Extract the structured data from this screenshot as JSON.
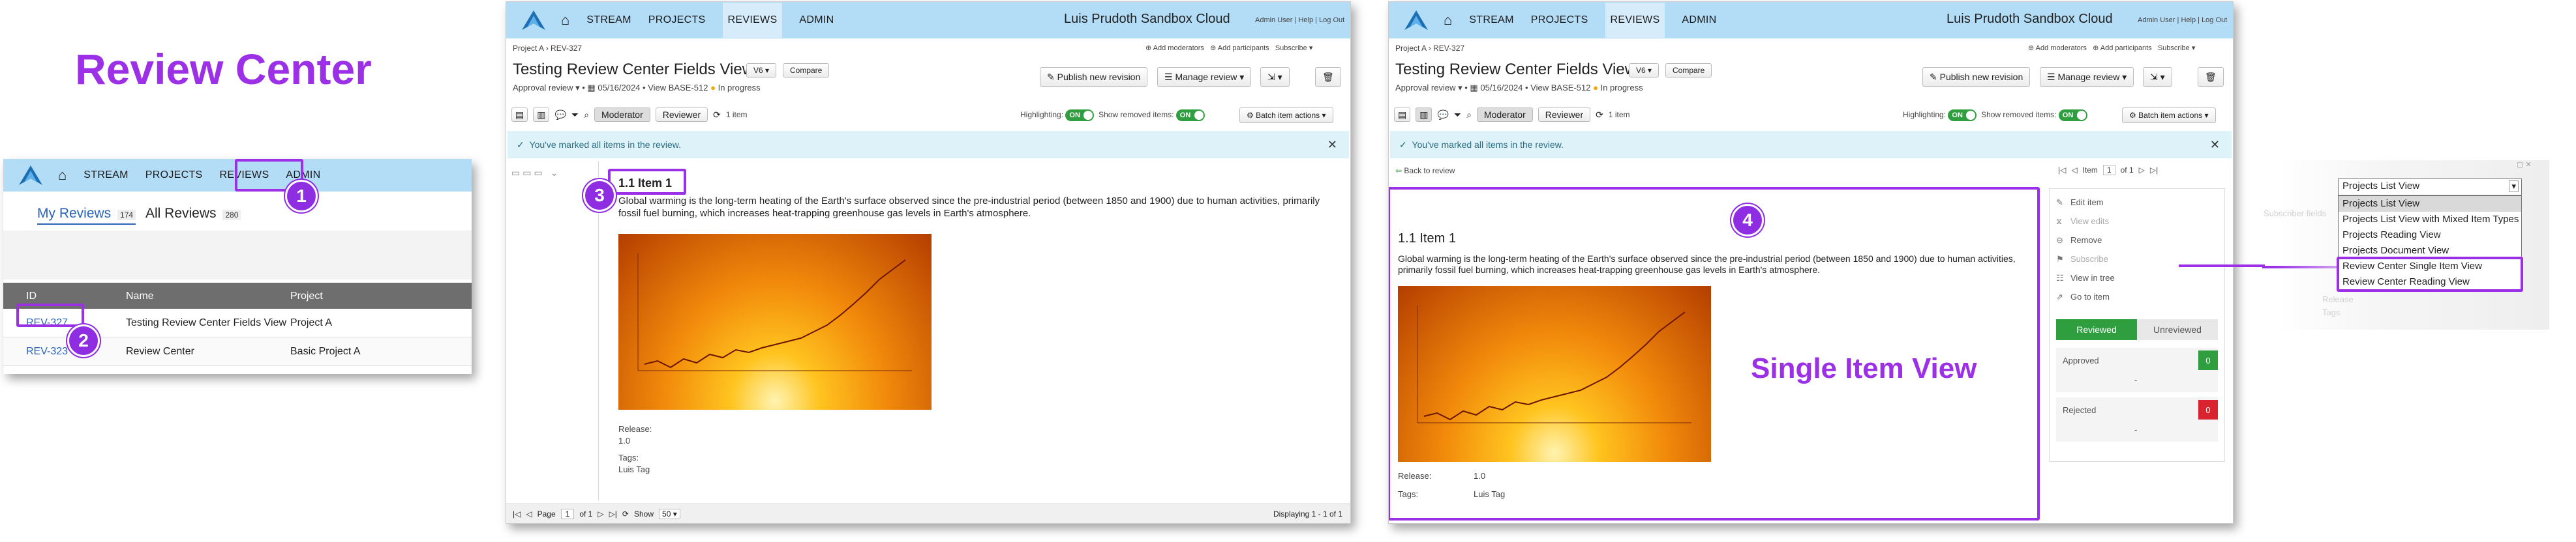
{
  "panel1": {
    "title": "Review Center",
    "nav": [
      "STREAM",
      "PROJECTS",
      "REVIEWS",
      "ADMIN"
    ],
    "tabs": [
      {
        "label": "My Reviews",
        "count": "174"
      },
      {
        "label": "All Reviews",
        "count": "280"
      }
    ],
    "columns": [
      "ID",
      "Name",
      "Project"
    ],
    "rows": [
      {
        "id": "REV-327",
        "name": "Testing Review Center Fields View",
        "project": "Project A"
      },
      {
        "id": "REV-323",
        "name": "Review Center",
        "project": "Basic Project A"
      }
    ],
    "callouts": [
      "1",
      "2"
    ]
  },
  "app": {
    "brand": "Luis Prudoth Sandbox Cloud",
    "nav": [
      "STREAM",
      "PROJECTS",
      "REVIEWS",
      "ADMIN"
    ],
    "user_links": [
      "Admin User",
      "Help",
      "Log Out"
    ],
    "breadcrumb": "Project A › REV-327",
    "add_moderators": "Add moderators",
    "add_participants": "Add participants",
    "subscribe": "Subscribe",
    "review_title": "Testing Review Center Fields View",
    "version": "V6",
    "compare": "Compare",
    "meta_type": "Approval review",
    "meta_date": "05/16/2024",
    "meta_view": "View BASE-512",
    "meta_status": "In progress",
    "publish": "Publish new revision",
    "manage": "Manage review",
    "moderator": "Moderator",
    "reviewer": "Reviewer",
    "item_count": "1 item",
    "highlighting": "Highlighting:",
    "show_removed": "Show removed items:",
    "toggle_on": "ON",
    "batch": "Batch item actions",
    "notice": "You've marked all items in the review."
  },
  "panel2": {
    "callout": "3",
    "item_heading": "1.1  Item 1",
    "description": "Global warming is the long-term heating of the Earth's surface observed since the pre-industrial period (between 1850 and 1900) due to human activities, primarily fossil fuel burning, which increases heat-trapping greenhouse gas levels in Earth's atmosphere.",
    "release_label": "Release:",
    "release_value": "1.0",
    "tags_label": "Tags:",
    "tags_value": "Luis Tag",
    "page_label": "Page",
    "page_value": "1",
    "page_of": "of 1",
    "show_label": "Show",
    "show_value": "50",
    "displaying": "Displaying 1 - 1 of 1"
  },
  "panel3": {
    "callout": "4",
    "back": "Back to review",
    "item_label": "Item",
    "item_value": "1",
    "item_of": "of 1",
    "item_heading": "1.1 Item 1",
    "single_view_label": "Single Item View",
    "release_label": "Release:",
    "release_value": "1.0",
    "tags_label": "Tags:",
    "tags_value": "Luis Tag",
    "actions": [
      "Edit item",
      "View edits",
      "Remove",
      "Subscribe",
      "View in tree",
      "Go to item"
    ],
    "reviewed": "Reviewed",
    "unreviewed": "Unreviewed",
    "approved": "Approved",
    "approved_count": "0",
    "rejected": "Rejected",
    "rejected_count": "0",
    "dash": "-"
  },
  "dropdown": {
    "selected": "Projects List View",
    "options": [
      "Projects List View",
      "Projects List View with Mixed Item Types",
      "Projects Reading View",
      "Projects Document View",
      "Review Center Single Item View",
      "Review Center Reading View"
    ],
    "ghost_label": "Subscriber fields",
    "ghost_release": "Release",
    "ghost_tags": "Tags"
  },
  "colors": {
    "accent_purple": "#9b30e6",
    "nav_blue": "#b3dcf6",
    "on_green": "#2e9e3e",
    "reject_red": "#d9232e"
  }
}
